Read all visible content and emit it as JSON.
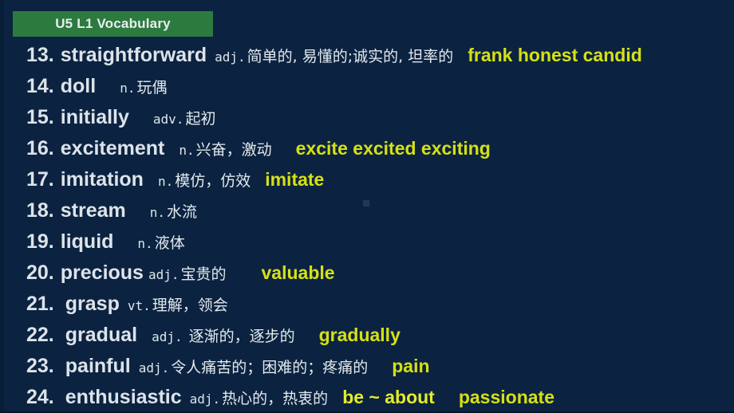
{
  "slide": {
    "background_color": "#0b2340",
    "accent_yellow": "#d6e015",
    "badge_green": "#2d7a3e",
    "text_color": "#dde3ea"
  },
  "title_badge": {
    "label": "U5 L1 Vocabulary"
  },
  "vocab_list": [
    {
      "num": "13.",
      "word": "straightforward",
      "pos": "adj.",
      "definition": "简单的, 易懂的;诚实的, 坦率的",
      "synonyms": "frank honest candid",
      "syn_bright": false
    },
    {
      "num": "14.",
      "word": "doll",
      "pos": "n.",
      "definition": "玩偶",
      "synonyms": "",
      "syn_bright": false
    },
    {
      "num": "15.",
      "word": "initially",
      "pos": "adv.",
      "definition": "起初",
      "synonyms": "",
      "syn_bright": false
    },
    {
      "num": "16.",
      "word": "excitement",
      "pos": "n.",
      "definition": "兴奋，激动",
      "synonyms": "excite  excited exciting",
      "syn_bright": false
    },
    {
      "num": "17.",
      "word": "imitation",
      "pos": "n.",
      "definition": "模仿，仿效",
      "synonyms": "imitate",
      "syn_bright": false
    },
    {
      "num": "18.",
      "word": "stream",
      "pos": "n.",
      "definition": "水流",
      "synonyms": "",
      "syn_bright": false
    },
    {
      "num": "19.",
      "word": "liquid",
      "pos": "n.",
      "definition": "液体",
      "synonyms": "",
      "syn_bright": false
    },
    {
      "num": "20.",
      "word": "precious",
      "pos": "adj.",
      "definition": "宝贵的",
      "synonyms": "valuable",
      "syn_bright": false
    },
    {
      "num": "21.",
      "word": "grasp",
      "pos": "vt.",
      "definition": "理解，领会",
      "synonyms": "",
      "syn_bright": false
    },
    {
      "num": "22.",
      "word": "gradual",
      "pos": "adj.",
      "definition": "逐渐的，逐步的",
      "synonyms": "gradually",
      "syn_bright": false
    },
    {
      "num": "23.",
      "word": "painful",
      "pos": "adj.",
      "definition": "令人痛苦的；困难的；疼痛的",
      "synonyms": "pain",
      "syn_bright": false
    },
    {
      "num": "24.",
      "word": "enthusiastic",
      "pos": "adj.",
      "definition": "热心的，热衷的",
      "synonyms": "be ~ about",
      "syn_bright": true,
      "synonyms2": "passionate"
    }
  ]
}
